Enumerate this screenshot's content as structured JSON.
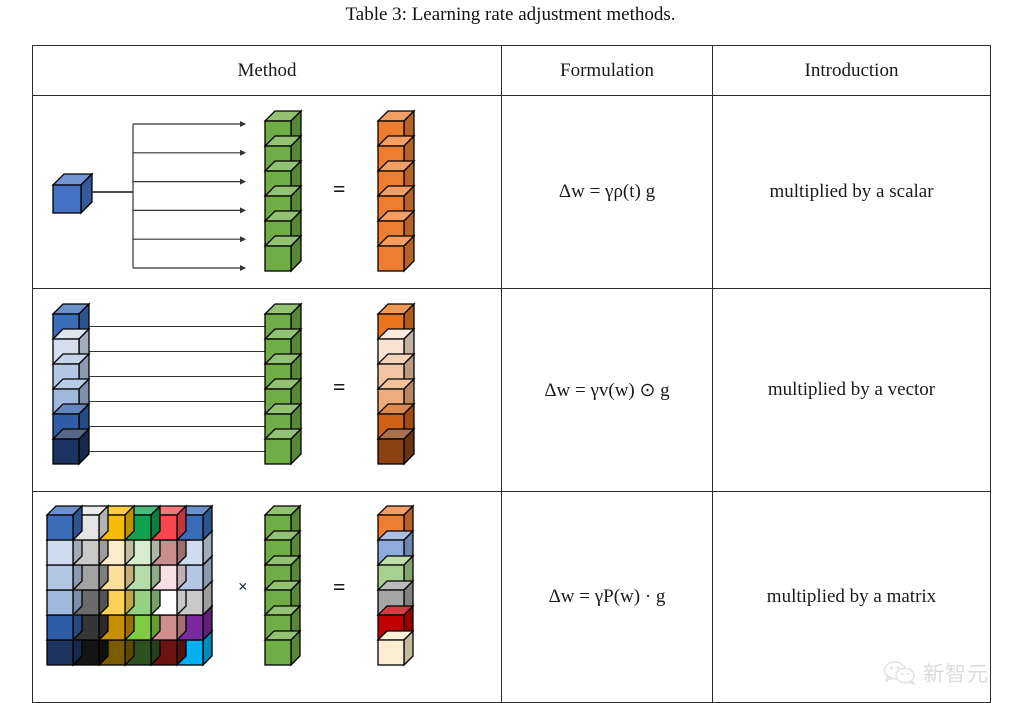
{
  "caption": "Table 3: Learning rate adjustment methods.",
  "table": {
    "headers": [
      "Method",
      "Formulation",
      "Introduction"
    ],
    "rows": [
      {
        "id": "scalar",
        "formula": {
          "lhs": "Δw",
          "eq": "=",
          "rhs": "γρ(t) g",
          "plain": "Δw = γρ(t) g"
        },
        "introduction": "multiplied by a scalar",
        "diagram": {
          "kind": "scalar-broadcast",
          "equals_sign": "=",
          "left_operand": {
            "type": "single-cube",
            "color": "#4472c4",
            "count": 1
          },
          "arrows": {
            "count": 6,
            "style": "fan-out"
          },
          "gradient_stack": {
            "type": "cube-column",
            "count": 6,
            "color": "#70ad47"
          },
          "result_stack": {
            "type": "cube-column",
            "count": 6,
            "color": "#ed7d31"
          }
        }
      },
      {
        "id": "vector",
        "formula": {
          "lhs": "Δw",
          "eq": "=",
          "rhs": "γv(w) ⊙ g",
          "plain": "Δw = γv(w) ⊙ g"
        },
        "introduction": "multiplied by a vector",
        "diagram": {
          "kind": "vector-elementwise",
          "equals_sign": "=",
          "left_operand": {
            "type": "cube-column",
            "count": 6,
            "colors": [
              "#3b6cb8",
              "#d3ddee",
              "#b3c6e3",
              "#9fb9dd",
              "#2f5da8",
              "#1d3461"
            ]
          },
          "arrows": {
            "count": 6,
            "style": "parallel"
          },
          "gradient_stack": {
            "type": "cube-column",
            "count": 6,
            "color": "#70ad47"
          },
          "result_stack": {
            "type": "cube-column",
            "count": 6,
            "colors": [
              "#e8751e",
              "#fae3d2",
              "#f3c6a3",
              "#eeac7c",
              "#cf6214",
              "#8c4112"
            ]
          }
        }
      },
      {
        "id": "matrix",
        "formula": {
          "lhs": "Δw",
          "eq": "=",
          "rhs": "γP(w) · g",
          "plain": "Δw = γP(w) · g"
        },
        "introduction": "multiplied by a matrix",
        "diagram": {
          "kind": "matrix-product",
          "times_sign": "×",
          "equals_sign": "=",
          "matrix": {
            "type": "cube-grid",
            "rows": 6,
            "cols": 6,
            "colors": [
              [
                "#3b6cb8",
                "#e4e4e4",
                "#f5bc00",
                "#10a24f",
                "#f8474f",
                "#3b6cb8"
              ],
              [
                "#cfdcef",
                "#c9c9c9",
                "#fbeccb",
                "#d8ecd0",
                "#c98d8d",
                "#cfdcef"
              ],
              [
                "#b3c6e3",
                "#a3a3a3",
                "#fbdf9e",
                "#b5dca8",
                "#fadfe6",
                "#b3c6e3"
              ],
              [
                "#9fb9dd",
                "#6b6b6b",
                "#fbd257",
                "#96d081",
                "#ffffff",
                "#c9c9c9"
              ],
              [
                "#2f5da8",
                "#363636",
                "#c79000",
                "#7fcb42",
                "#d08d8d",
                "#7a2c9e"
              ],
              [
                "#1d3461",
                "#141414",
                "#7a5c00",
                "#2f5120",
                "#6d1410",
                "#00b0f0"
              ]
            ]
          },
          "gradient_stack": {
            "type": "cube-column",
            "count": 6,
            "color": "#70ad47"
          },
          "result_stack": {
            "type": "cube-column",
            "count": 6,
            "colors": [
              "#ed7d31",
              "#8faadc",
              "#a9d18e",
              "#a6a6a6",
              "#c00000",
              "#fbeed0"
            ]
          }
        }
      }
    ]
  },
  "watermark": {
    "text": "新智元",
    "icon": "wechat-icon"
  },
  "colors": {
    "blue": "#4472c4",
    "green": "#70ad47",
    "orange": "#ed7d31",
    "border": "#2b2b2b",
    "text": "#1a1a1a"
  }
}
